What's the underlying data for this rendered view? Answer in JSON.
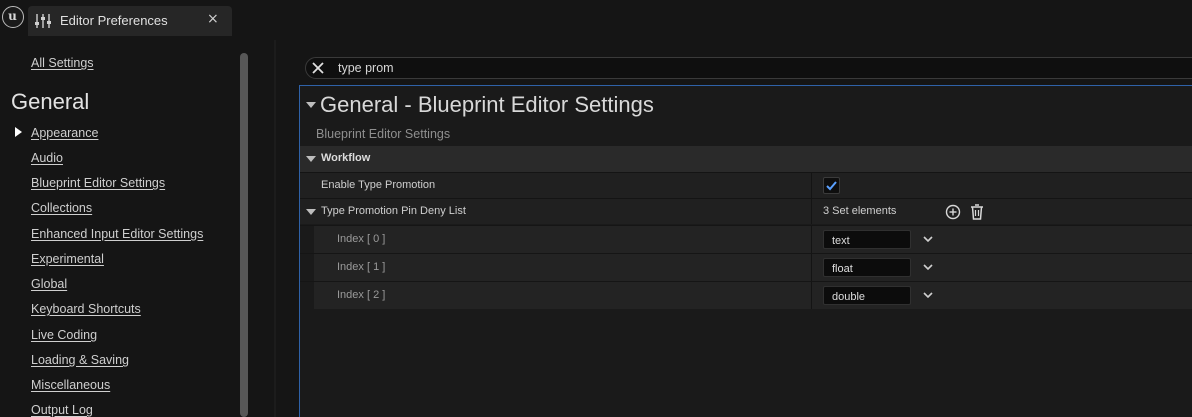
{
  "titlebar": {
    "logo_glyph": "u",
    "tab_title": "Editor Preferences",
    "tab_close": "×"
  },
  "sidebar": {
    "all_settings": "All Settings",
    "heading": "General",
    "items": [
      {
        "label": "Appearance"
      },
      {
        "label": "Audio"
      },
      {
        "label": "Blueprint Editor Settings"
      },
      {
        "label": "Collections"
      },
      {
        "label": "Enhanced Input Editor Settings"
      },
      {
        "label": "Experimental"
      },
      {
        "label": "Global"
      },
      {
        "label": "Keyboard Shortcuts"
      },
      {
        "label": "Live Coding"
      },
      {
        "label": "Loading & Saving"
      },
      {
        "label": "Miscellaneous"
      },
      {
        "label": "Output Log"
      }
    ]
  },
  "search": {
    "value": "type prom"
  },
  "details": {
    "section_title": "General - Blueprint Editor Settings",
    "section_subtitle": "Blueprint Editor Settings",
    "category": "Workflow",
    "enable_type_promotion": {
      "label": "Enable Type Promotion",
      "checked": true
    },
    "deny_list": {
      "label": "Type Promotion Pin Deny List",
      "count_text": "3 Set elements",
      "elements": [
        {
          "index": "Index [ 0 ]",
          "value": "text"
        },
        {
          "index": "Index [ 1 ]",
          "value": "float"
        },
        {
          "index": "Index [ 2 ]",
          "value": "double"
        }
      ]
    }
  },
  "colors": {
    "accent": "#2f62a8",
    "check": "#5aa0ff",
    "background": "#151515"
  },
  "icons": [
    "unreal-logo-icon",
    "settings-sliders-icon",
    "close-icon",
    "clear-search-icon",
    "collapse-arrow-icon",
    "checkmark-icon",
    "add-circle-icon",
    "trash-icon",
    "chevron-down-icon",
    "expand-arrow-icon"
  ]
}
